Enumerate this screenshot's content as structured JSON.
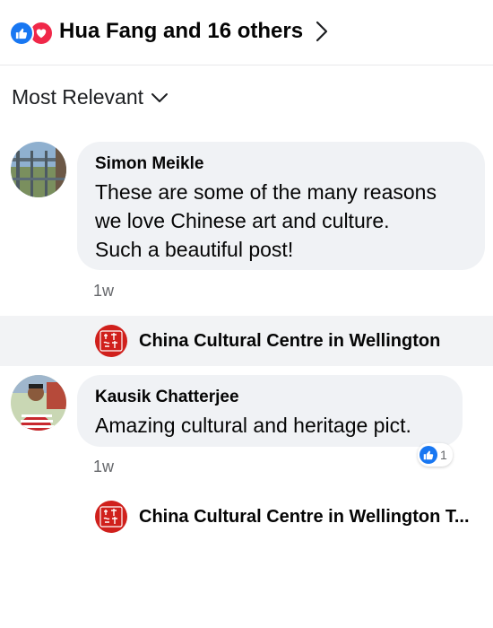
{
  "header": {
    "reactions_label": "Hua Fang and 16 others",
    "reaction_icons": [
      "like-icon",
      "love-icon"
    ],
    "like_color": "#1877f2",
    "love_color": "#f02849"
  },
  "sort": {
    "label": "Most Relevant"
  },
  "comments": [
    {
      "author": "Simon Meikle",
      "text_lines": [
        "These are some of the many reasons",
        "we love Chinese art and culture.",
        "Such a beautiful post!"
      ],
      "time": "1w",
      "reply_from": "China Cultural Centre in Wellington"
    },
    {
      "author": "Kausik Chatterjee",
      "text_lines": [
        "Amazing cultural and heritage pict."
      ],
      "time": "1w",
      "reaction_count": "1",
      "reply_from": "China Cultural Centre in Wellington T..."
    }
  ],
  "logo": {
    "glyph_top": "中和中",
    "glyph_bottom": "化化心"
  }
}
